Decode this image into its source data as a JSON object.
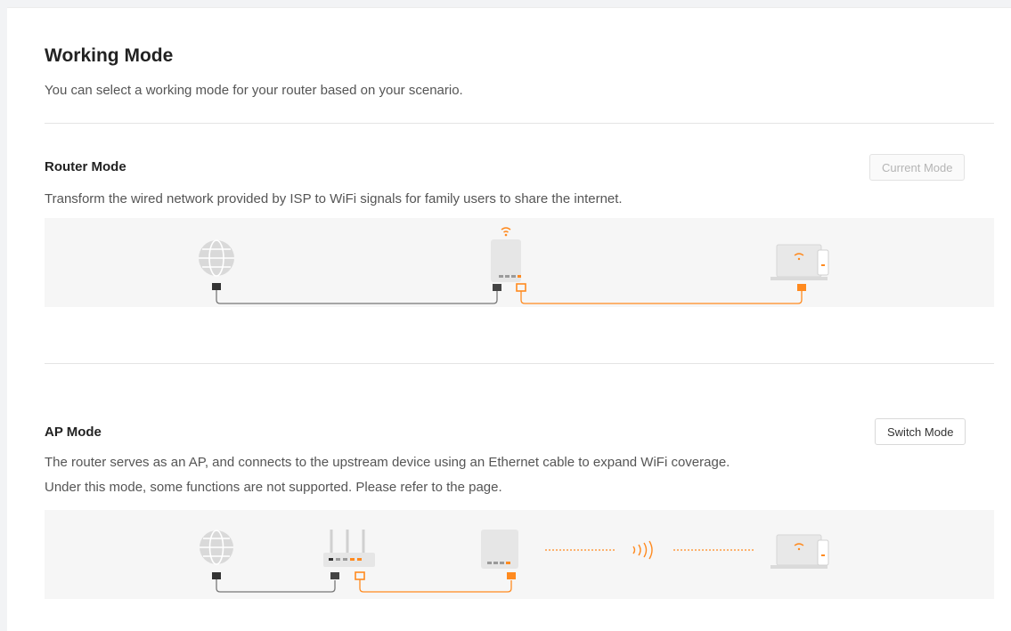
{
  "header": {
    "title": "Working Mode",
    "subtitle": "You can select a working mode for your router based on your scenario."
  },
  "modes": [
    {
      "title": "Router Mode",
      "description": "Transform the wired network provided by ISP to WiFi signals for family users to share the internet.",
      "button_label": "Current Mode",
      "button_enabled": false,
      "diagram_icons": [
        "globe-icon",
        "router-icon",
        "wifi-signal-icon",
        "laptop-icon",
        "phone-icon"
      ]
    },
    {
      "title": "AP Mode",
      "description_line1": "The router serves as an AP, and connects to the upstream device using an Ethernet cable to expand WiFi coverage.",
      "description_line2": "Under this mode, some functions are not supported. Please refer to the page.",
      "button_label": "Switch Mode",
      "button_enabled": true,
      "diagram_icons": [
        "globe-icon",
        "upstream-router-icon",
        "router-icon",
        "wireless-signal-icon",
        "laptop-icon",
        "phone-icon"
      ]
    }
  ],
  "colors": {
    "accent": "#ff8a1f",
    "wired_cable": "#888888",
    "device_gray": "#e6e6e6",
    "diagram_background": "#f6f6f6"
  }
}
